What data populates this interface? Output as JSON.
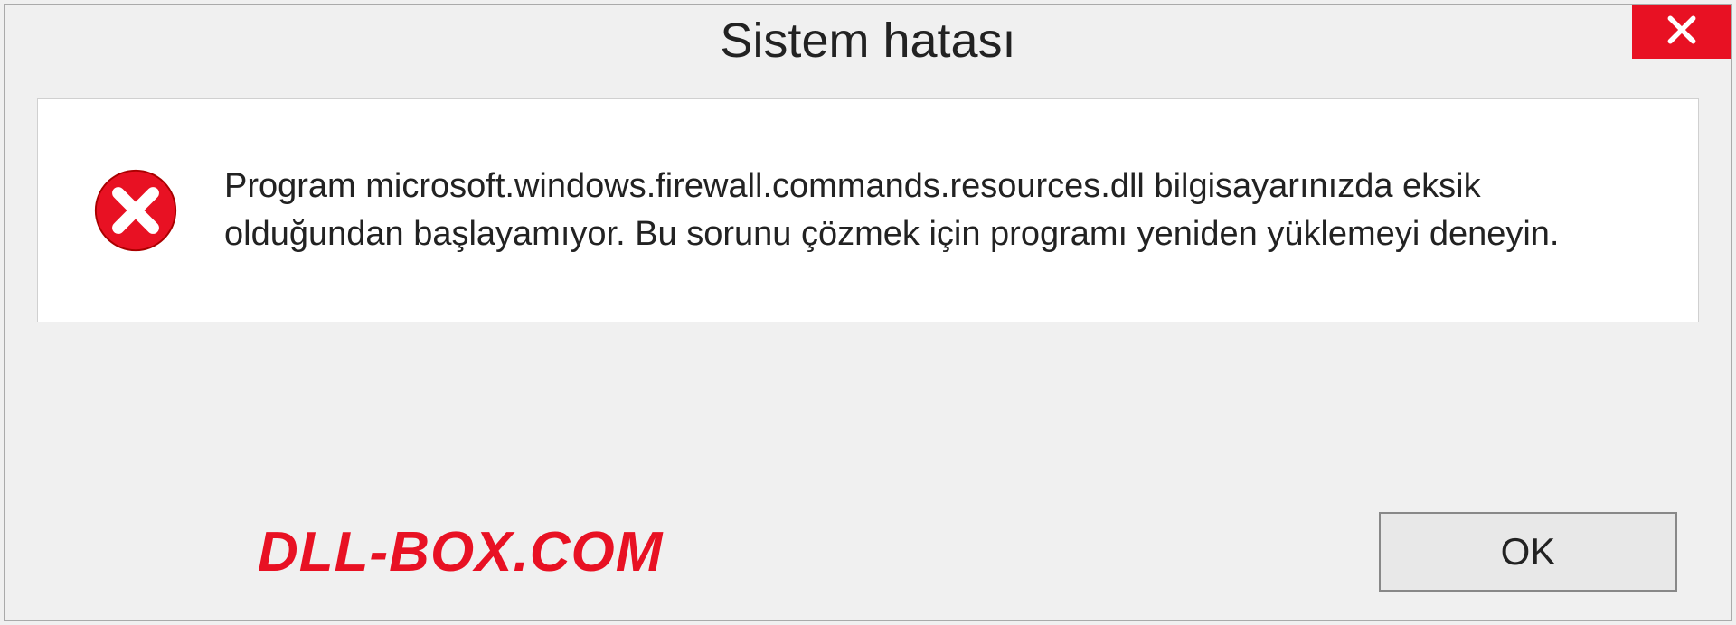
{
  "dialog": {
    "title": "Sistem hatası",
    "message": "Program microsoft.windows.firewall.commands.resources.dll bilgisayarınızda eksik olduğundan başlayamıyor. Bu sorunu çözmek için programı yeniden yüklemeyi deneyin.",
    "ok_label": "OK",
    "watermark": "DLL-BOX.COM"
  }
}
